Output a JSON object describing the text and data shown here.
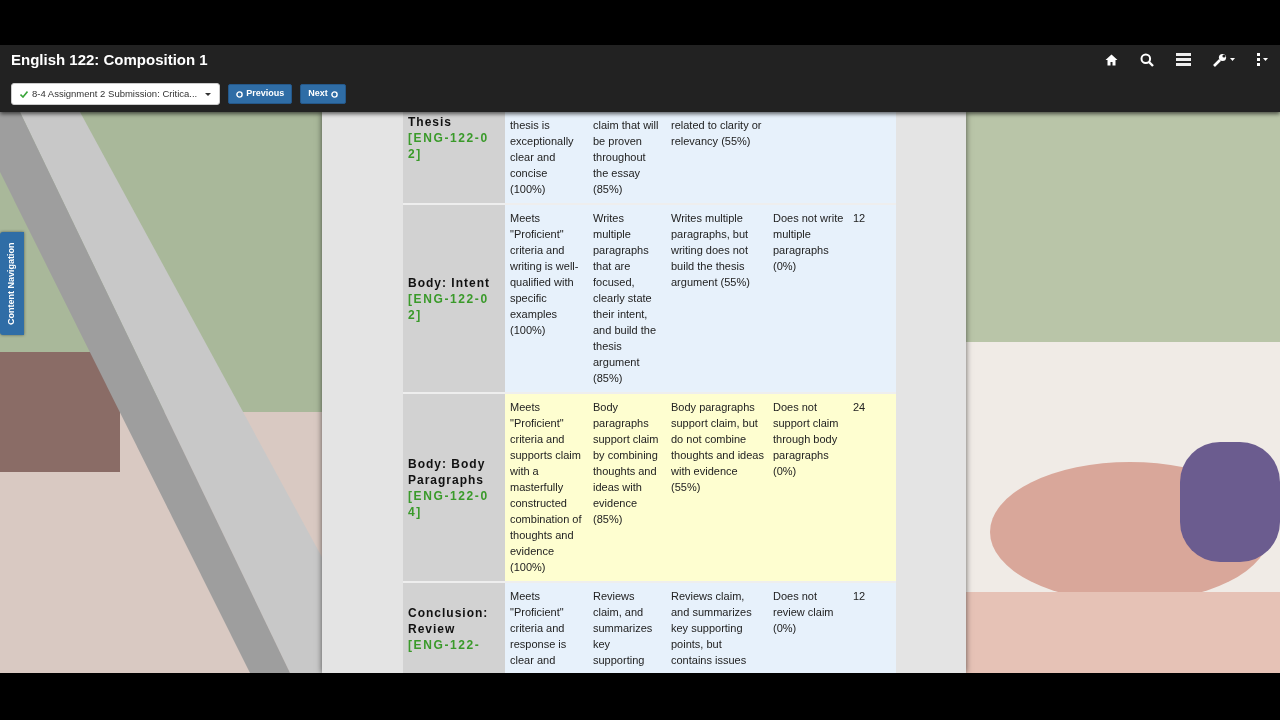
{
  "header": {
    "title": "English 122: Composition 1",
    "assignment_menu": {
      "label": "8-4 Assignment 2 Submission: Critica...",
      "checked": true
    },
    "previous_button": "Previous",
    "next_button": "Next"
  },
  "side_tab": {
    "label": "Content Navigation"
  },
  "rubric": {
    "rows": [
      {
        "criterion": "Thesis",
        "code": "[ENG-122-02]",
        "selected": false,
        "levels": [
          "thesis is exceptionally clear and concise (100%)",
          "claim that will be proven throughout the essay (85%)",
          "related to clarity or relevancy (55%)"
        ]
      },
      {
        "criterion": "Body: Intent",
        "code": "[ENG-122-02]",
        "selected": false,
        "levels": [
          "Meets \"Proficient\" criteria and writing is well-qualified with specific examples (100%)",
          "Writes multiple paragraphs that are focused, clearly state their intent, and build the thesis argument (85%)",
          "Writes multiple paragraphs, but writing does not build the thesis argument (55%)",
          "Does not write multiple paragraphs (0%)"
        ],
        "points": "12"
      },
      {
        "criterion": "Body: Body Paragraphs",
        "code": "[ENG-122-04]",
        "selected": true,
        "levels": [
          "Meets \"Proficient\" criteria and supports claim with a masterfully constructed combination of thoughts and evidence (100%)",
          "Body paragraphs support claim by combining thoughts and ideas with evidence (85%)",
          "Body paragraphs support claim, but do not combine thoughts and ideas with evidence (55%)",
          "Does not support claim through body paragraphs (0%)"
        ],
        "points": "24"
      },
      {
        "criterion": "Conclusion: Review",
        "code": "[ENG-122-",
        "selected": false,
        "levels": [
          "Meets \"Proficient\" criteria and response is clear and",
          "Reviews claim, and summarizes key supporting",
          "Reviews claim, and summarizes key supporting points, but contains issues",
          "Does not review claim (0%)"
        ],
        "points": "12"
      }
    ]
  }
}
